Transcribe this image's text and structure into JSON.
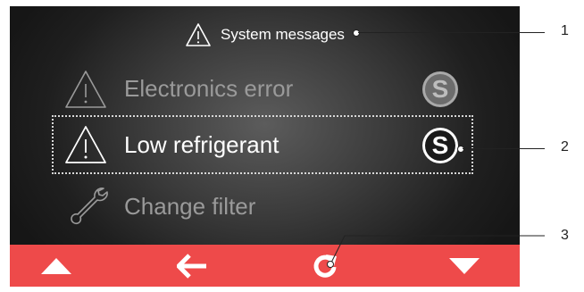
{
  "header": {
    "icon": "warning-triangle-icon",
    "title": "System messages"
  },
  "messages": [
    {
      "icon": "warning-triangle-icon",
      "label": "Electronics error",
      "badge": "S",
      "state": "dimmed"
    },
    {
      "icon": "warning-triangle-icon",
      "label": "Low refrigerant",
      "badge": "S",
      "state": "selected"
    },
    {
      "icon": "wrench-icon",
      "label": "Change filter",
      "badge": "",
      "state": "dimmed"
    }
  ],
  "navbar": {
    "buttons": [
      {
        "name": "scroll-up-button",
        "icon": "triangle-up-icon"
      },
      {
        "name": "back-button",
        "icon": "arrow-left-icon"
      },
      {
        "name": "refresh-button",
        "icon": "refresh-icon"
      },
      {
        "name": "scroll-down-button",
        "icon": "triangle-down-icon"
      }
    ],
    "color": "#ee4a4a"
  },
  "callouts": [
    "1",
    "2",
    "3"
  ]
}
